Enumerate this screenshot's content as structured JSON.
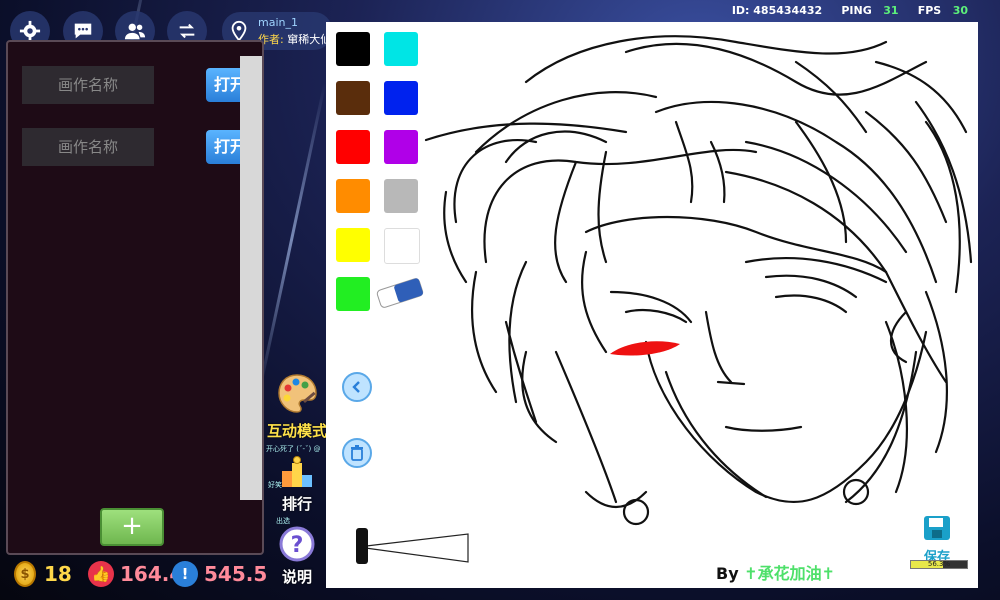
{
  "topbar": {
    "map_name": "main_1",
    "author_label": "作者:",
    "author_name": "窜稀大仙",
    "id_text": "ID: 485434432",
    "ping_label": "PING",
    "ping_value": "31",
    "fps_label": "FPS",
    "fps_value": "30",
    "icons": [
      "gear-icon",
      "chat-icon",
      "friends-icon",
      "swap-icon",
      "map-pin-icon"
    ]
  },
  "left_panel": {
    "rows": [
      {
        "placeholder": "画作名称",
        "button": "打开"
      },
      {
        "placeholder": "画作名称",
        "button": "打开"
      }
    ],
    "add_label": "+"
  },
  "currency": {
    "coins": "18",
    "likes": "164.4",
    "points": "545.5"
  },
  "side_buttons": {
    "interactive_label": "互动模式",
    "interactive_note": "开心死了 (ˇ-ˇ) @",
    "ranking_label": "排行",
    "ranking_note1": "好笑",
    "ranking_note2": "出选",
    "help_label": "说明"
  },
  "palette": {
    "colors": [
      "#000000",
      "#00e5e5",
      "#5a2d0c",
      "#0022ee",
      "#ff0000",
      "#b000e8",
      "#ff8c00",
      "#b8b8b8",
      "#ffff00",
      "#ffffff",
      "#22ee22"
    ],
    "eraser": "eraser-icon"
  },
  "canvas": {
    "byline_prefix": "By ",
    "byline_author": "✝承花加油✝",
    "save_label": "保存",
    "progress_text": "56.3%",
    "progress_value": 0.563
  }
}
